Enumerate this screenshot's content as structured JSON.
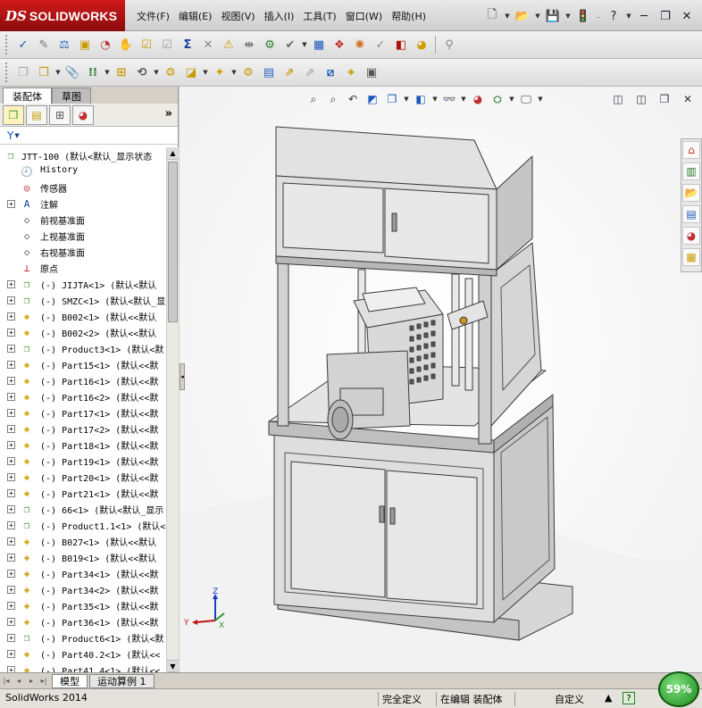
{
  "app": {
    "logo_ds": "DS",
    "logo_name": "SOLIDWORKS"
  },
  "menu": [
    "文件(F)",
    "编辑(E)",
    "视图(V)",
    "插入(I)",
    "工具(T)",
    "窗口(W)",
    "帮助(H)"
  ],
  "panel": {
    "tabs": [
      "装配体",
      "草图"
    ],
    "more": "»",
    "filter_icon": "▼"
  },
  "tree": {
    "root": "JTT-100  (默认<默认_显示状态",
    "features": [
      {
        "label": "History",
        "icon": "history-icon"
      },
      {
        "label": "传感器",
        "icon": "sensor-icon"
      },
      {
        "label": "注解",
        "icon": "annotation-icon"
      },
      {
        "label": "前视基准面",
        "icon": "plane-icon"
      },
      {
        "label": "上视基准面",
        "icon": "plane-icon"
      },
      {
        "label": "右视基准面",
        "icon": "plane-icon"
      },
      {
        "label": "原点",
        "icon": "origin-icon"
      }
    ],
    "components": [
      {
        "label": "(-) JIJTA<1>  (默认<默认",
        "kind": "assembly"
      },
      {
        "label": "(-) SMZC<1>  (默认<默认_显",
        "kind": "assembly"
      },
      {
        "label": "(-) B002<1>  (默认<<默认",
        "kind": "part"
      },
      {
        "label": "(-) B002<2>  (默认<<默认",
        "kind": "part"
      },
      {
        "label": "(-) Product3<1>  (默认<默",
        "kind": "assembly"
      },
      {
        "label": "(-) Part15<1>  (默认<<默",
        "kind": "part"
      },
      {
        "label": "(-) Part16<1>  (默认<<默",
        "kind": "part"
      },
      {
        "label": "(-) Part16<2>  (默认<<默",
        "kind": "part"
      },
      {
        "label": "(-) Part17<1>  (默认<<默",
        "kind": "part"
      },
      {
        "label": "(-) Part17<2>  (默认<<默",
        "kind": "part"
      },
      {
        "label": "(-) Part18<1>  (默认<<默",
        "kind": "part"
      },
      {
        "label": "(-) Part19<1>  (默认<<默",
        "kind": "part"
      },
      {
        "label": "(-) Part20<1>  (默认<<默",
        "kind": "part"
      },
      {
        "label": "(-) Part21<1>  (默认<<默",
        "kind": "part"
      },
      {
        "label": "(-) 66<1>  (默认<默认_显示",
        "kind": "assembly"
      },
      {
        "label": "(-) Product1.1<1>  (默认<",
        "kind": "assembly"
      },
      {
        "label": "(-) B027<1>  (默认<<默认",
        "kind": "part"
      },
      {
        "label": "(-) B019<1>  (默认<<默认",
        "kind": "part"
      },
      {
        "label": "(-) Part34<1>  (默认<<默",
        "kind": "part"
      },
      {
        "label": "(-) Part34<2>  (默认<<默",
        "kind": "part"
      },
      {
        "label": "(-) Part35<1>  (默认<<默",
        "kind": "part"
      },
      {
        "label": "(-) Part36<1>  (默认<<默",
        "kind": "part"
      },
      {
        "label": "(-) Product6<1>  (默认<默",
        "kind": "assembly"
      },
      {
        "label": "(-) Part40.2<1>  (默认<<",
        "kind": "part"
      },
      {
        "label": "(-) Part41.4<1>  (默认<<",
        "kind": "part"
      }
    ]
  },
  "bottom_tabs": [
    "模型",
    "运动算例 1"
  ],
  "status": {
    "app_version": "SolidWorks 2014",
    "definition": "完全定义",
    "editing": "在编辑 装配体",
    "units": "自定义",
    "help": "?",
    "performance": "59%"
  },
  "triad": {
    "x": "X",
    "y": "Y",
    "z": "Z"
  },
  "colors": {
    "logo_red": "#c01414",
    "model_gray": "#dcdcdc",
    "accent_green": "#2e9a2e"
  }
}
